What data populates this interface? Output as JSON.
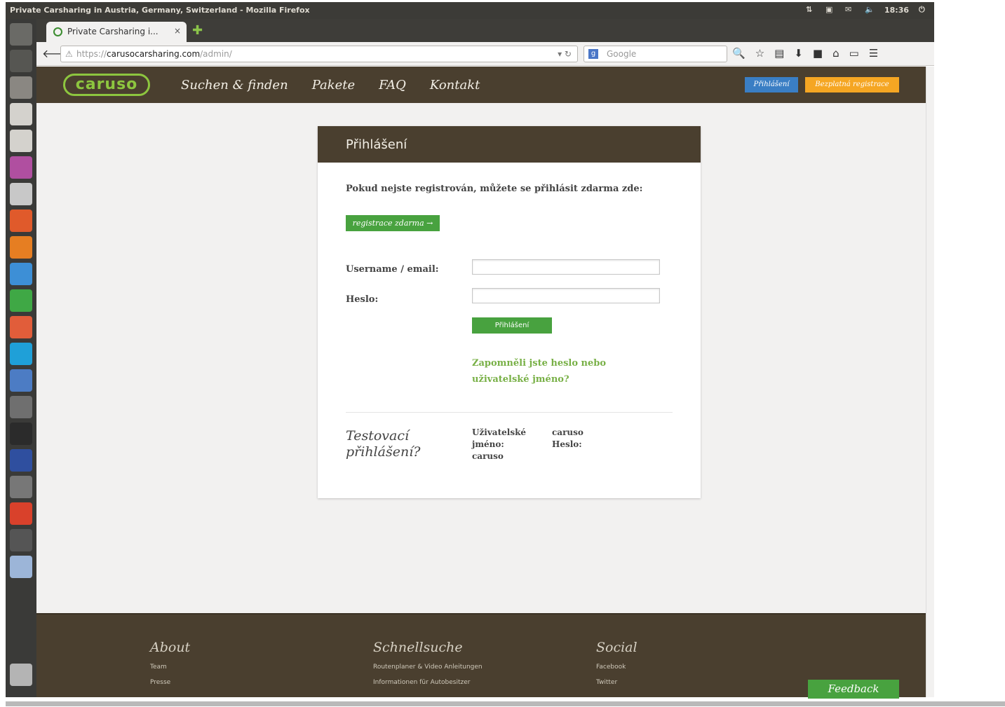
{
  "window": {
    "title": "Private Carsharing in Austria, Germany, Switzerland - Mozilla Firefox",
    "clock": "18:36"
  },
  "browser": {
    "tab_title": "Private Carsharing i...",
    "tab_close": "×",
    "new_tab": "✚",
    "url_scheme": "https://",
    "url_host": "carusocarsharing.com",
    "url_path": "/admin/",
    "search_placeholder": "Google"
  },
  "site": {
    "logo": "caruso",
    "nav": [
      "Suchen & finden",
      "Pakete",
      "FAQ",
      "Kontakt"
    ],
    "login_button": "Přihlášení",
    "register_button": "Bezplatná registrace"
  },
  "login": {
    "heading": "Přihlášení",
    "intro": "Pokud nejste registrován, můžete se přihlásit zdarma zde:",
    "register_free": "registrace zdarma →",
    "username_label": "Username / email:",
    "username_value": "",
    "password_label": "Heslo:",
    "password_value": "",
    "submit": "Přihlášení",
    "forgot": "Zapomněli jste heslo nebo uživatelské jméno?",
    "test_title": "Testovací přihlášení?",
    "test_user_label": "Uživatelské jméno:",
    "test_user_value": "caruso",
    "test_pass_label": "Heslo:",
    "test_pass_value": "caruso"
  },
  "footer": {
    "about_heading": "About",
    "about_links": [
      "Team",
      "Presse"
    ],
    "quick_heading": "Schnellsuche",
    "quick_links": [
      "Routenplaner & Video Anleitungen",
      "Informationen für Autobesitzer"
    ],
    "social_heading": "Social",
    "social_links": [
      "Facebook",
      "Twitter"
    ],
    "feedback": "Feedback"
  },
  "colors": {
    "brand_brown": "#4a3f2f",
    "brand_green": "#48a23f",
    "logo_green": "#8dc63f",
    "login_blue": "#3a7ec4",
    "register_orange": "#f5a623"
  }
}
